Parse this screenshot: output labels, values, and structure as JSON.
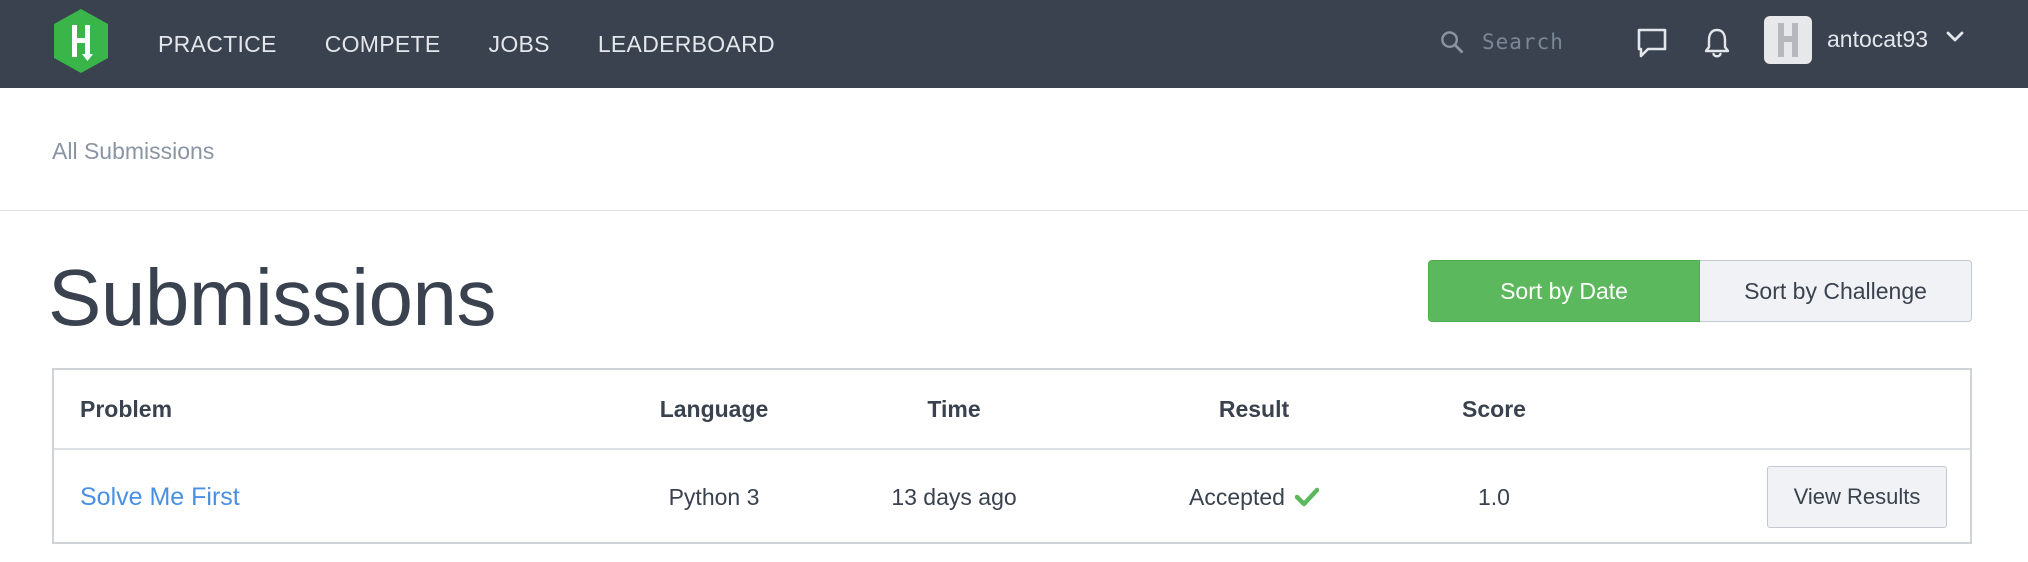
{
  "header": {
    "logo_icon": "hackerrank-h-icon",
    "nav": [
      {
        "label": "PRACTICE"
      },
      {
        "label": "COMPETE"
      },
      {
        "label": "JOBS"
      },
      {
        "label": "LEADERBOARD"
      }
    ],
    "search": {
      "placeholder": "Search",
      "icon": "search-icon"
    },
    "icons": [
      "chat-icon",
      "bell-icon",
      "chevron-down-icon"
    ],
    "user": {
      "name": "antocat93"
    }
  },
  "breadcrumb": {
    "label": "All Submissions"
  },
  "page": {
    "title": "Submissions",
    "sort": {
      "active_label": "Sort by Date",
      "inactive_label": "Sort by Challenge"
    }
  },
  "table": {
    "columns": [
      "Problem",
      "Language",
      "Time",
      "Result",
      "Score"
    ],
    "rows": [
      {
        "problem": "Solve Me First",
        "language": "Python 3",
        "time": "13 days ago",
        "result": "Accepted",
        "score": "1.0",
        "action": "View Results"
      }
    ]
  },
  "colors": {
    "topbar": "#39424e",
    "brand_green": "#5cb85c",
    "link_blue": "#4a90e2"
  }
}
